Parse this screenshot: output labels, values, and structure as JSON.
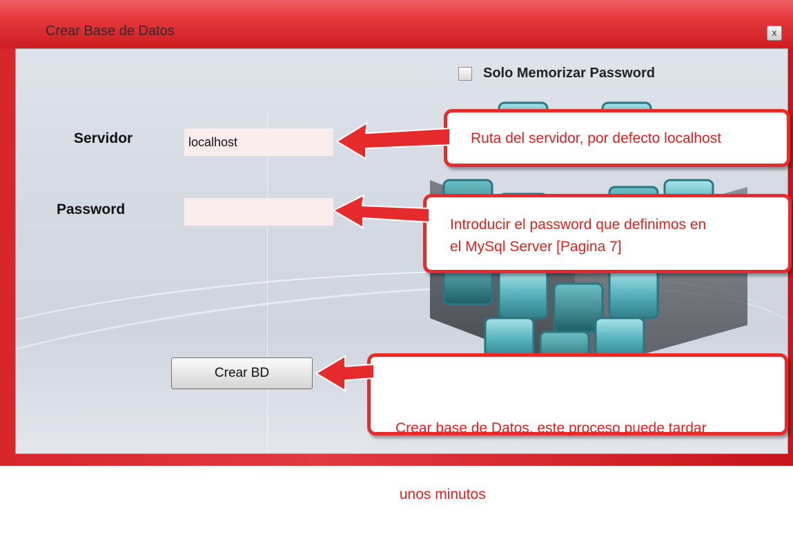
{
  "window": {
    "title": "Crear Base de Datos",
    "close_label": "x"
  },
  "form": {
    "checkbox_label": "Solo Memorizar Password",
    "checkbox_checked": false,
    "server_label": "Servidor",
    "server_value": "localhost",
    "password_label": "Password",
    "password_value": "",
    "create_button_label": "Crear BD"
  },
  "callouts": {
    "server": "Ruta del servidor, por defecto localhost",
    "password_line1": "Introducir el password que definimos en",
    "password_line2": "el MySql Server [Pagina 7]",
    "create_line1": "Crear base de Datos, este proceso puede tardar",
    "create_line2": " unos minutos"
  },
  "colors": {
    "accent_red": "#e52b2b",
    "title_red": "#e5373c",
    "cube_teal": "#5fb9c2"
  }
}
